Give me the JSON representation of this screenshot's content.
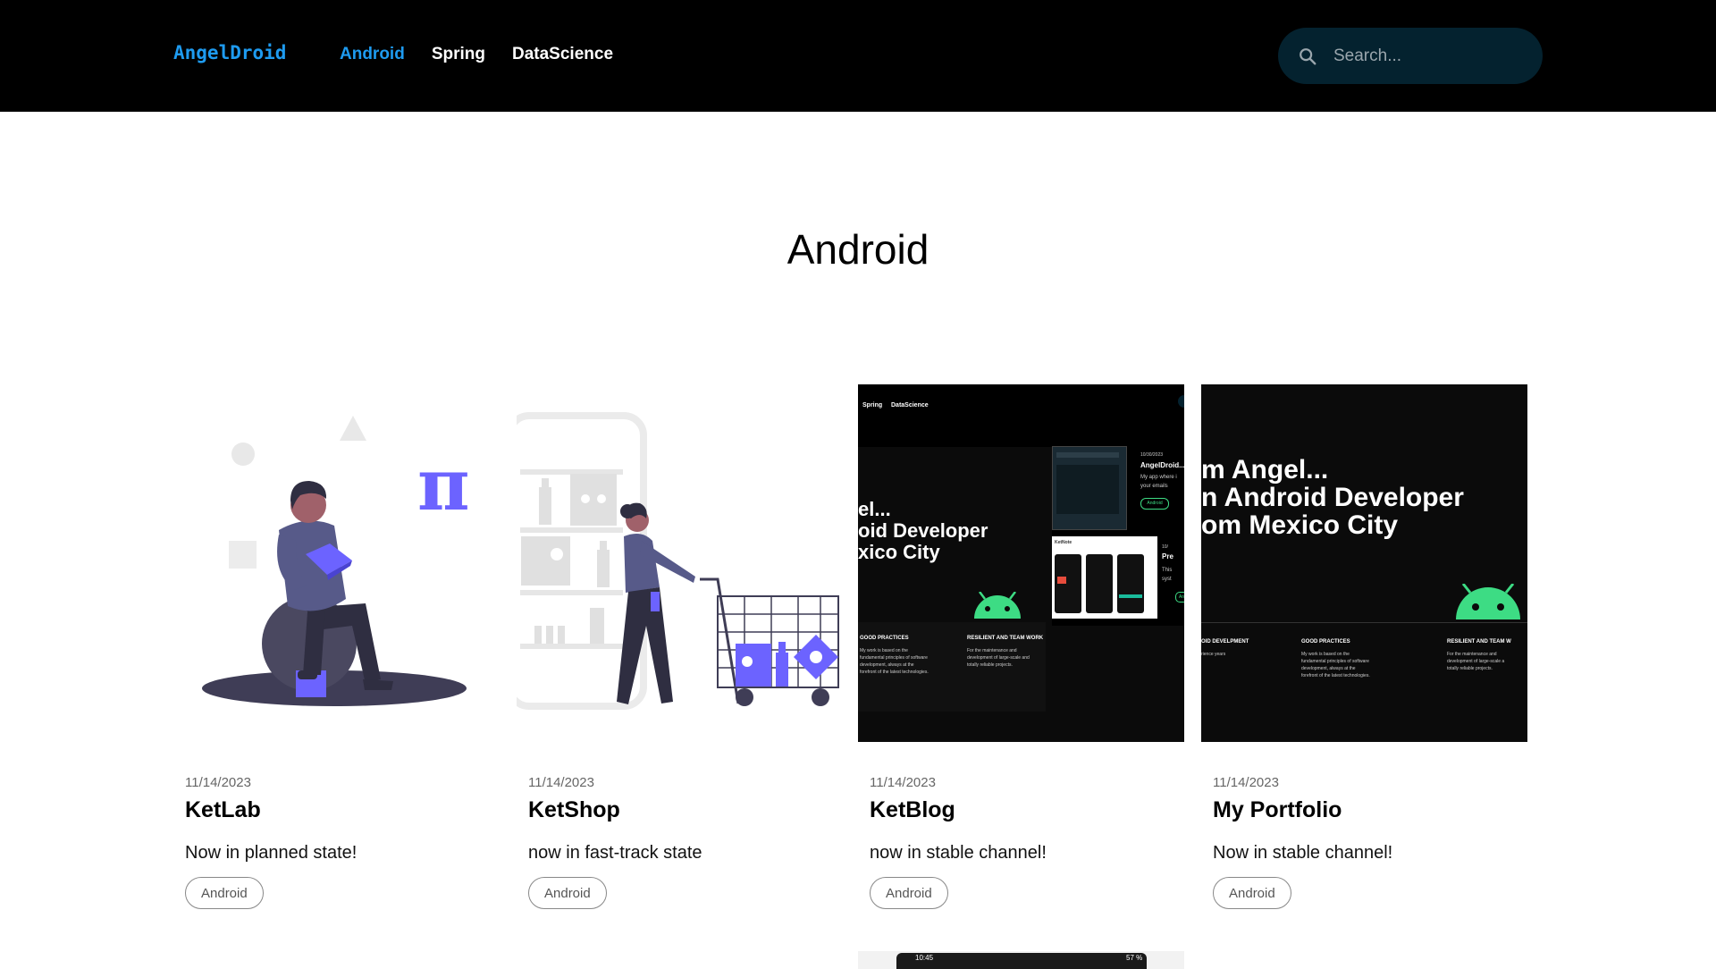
{
  "header": {
    "logo": "AngelDroid",
    "nav": [
      {
        "label": "Android",
        "active": true
      },
      {
        "label": "Spring",
        "active": false
      },
      {
        "label": "DataScience",
        "active": false
      }
    ],
    "search_placeholder": "Search..."
  },
  "page": {
    "title": "Android"
  },
  "cards": [
    {
      "date": "11/14/2023",
      "title": "KetLab",
      "description": "Now in planned state!",
      "tag": "Android",
      "image_icon": "reading-person-illustration"
    },
    {
      "date": "11/14/2023",
      "title": "KetShop",
      "description": "now in fast-track state",
      "tag": "Android",
      "image_icon": "shopping-cart-illustration"
    },
    {
      "date": "11/14/2023",
      "title": "KetBlog",
      "description": "now in stable channel!",
      "tag": "Android",
      "image_icon": "website-screenshot"
    },
    {
      "date": "11/14/2023",
      "title": "My Portfolio",
      "description": "Now in stable channel!",
      "tag": "Android",
      "image_icon": "website-screenshot"
    }
  ],
  "thumb3": {
    "nav_1": "Spring",
    "nav_2": "DataScience",
    "line1": "el...",
    "line2": "oid Developer",
    "line3": "xico City",
    "col1_title": "GOOD PRACTICES",
    "col1_text": [
      "My work is based on the",
      "fundamental principles of software",
      "development, always at the",
      "forefront of the latest technologies."
    ],
    "col2_title": "RESILIENT AND TEAM WORK",
    "col2_text": [
      "For the maintenance and",
      "development of large-scale and",
      "totally reliable projects."
    ],
    "post_date": "10/30/2023",
    "post_title": "AngelDroid...",
    "post_text": [
      "My app where i",
      "your emails"
    ],
    "post_tag": "Android",
    "ketnote_label": "KetNote",
    "post2_date": "10/",
    "post2_title": "Pre",
    "post2_text": [
      "This",
      "syst"
    ],
    "post2_tag": "An"
  },
  "thumb4": {
    "line1": "m Angel...",
    "line2": "n Android Developer",
    "line3": "om Mexico City",
    "col0_title": "OID DEVELPMENT",
    "col0_text": [
      "rience years"
    ],
    "col1_title": "GOOD PRACTICES",
    "col1_text": [
      "My work is based on the",
      "fundamental principles of software",
      "development, always at the",
      "forefront of the latest technologies."
    ],
    "col2_title": "RESILIENT AND TEAM W",
    "col2_text": [
      "For the maintenance and",
      "development of large-scale a",
      "totally reliable projects."
    ]
  },
  "bottom_strip": {
    "time": "10:45",
    "battery": "57 %"
  },
  "colors": {
    "accent": "#1e9bf0",
    "header_bg": "#000000",
    "search_bg": "#04222f",
    "illustration_purple": "#6c63ff",
    "android_green": "#3ddc84"
  }
}
